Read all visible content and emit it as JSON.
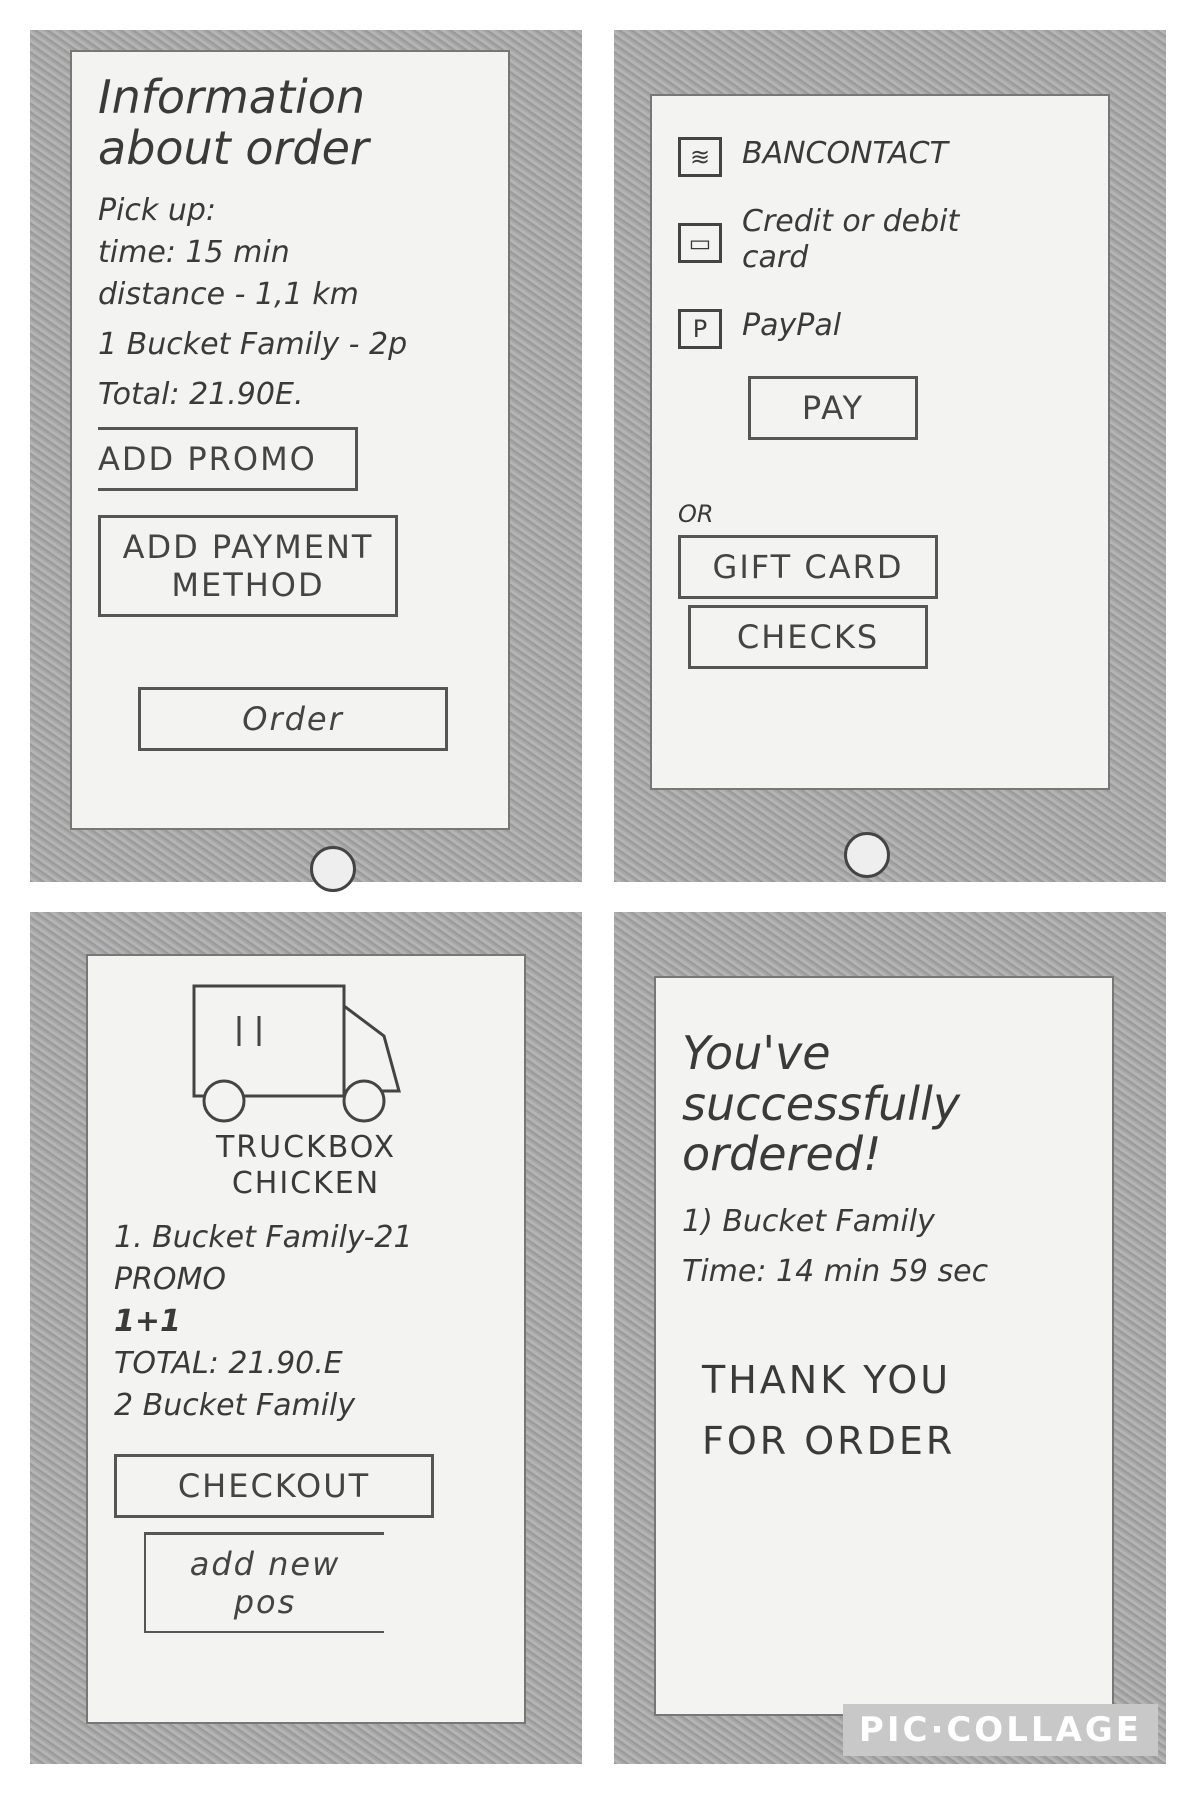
{
  "screen1": {
    "title": "Information about order",
    "pickup_label": "Pick up:",
    "time": "time: 15 min",
    "distance": "distance - 1,1 km",
    "item": "1 Bucket Family - 2p",
    "total": "Total: 21.90E.",
    "add_promo": "ADD PROMO",
    "add_payment": "ADD PAYMENT METHOD",
    "order": "Order"
  },
  "screen2": {
    "methods": [
      {
        "label": "BANCONTACT",
        "icon": "bancontact-icon"
      },
      {
        "label": "Credit or debit card",
        "icon": "card-icon"
      },
      {
        "label": "PayPal",
        "icon": "paypal-icon",
        "glyph": "P"
      }
    ],
    "pay": "PAY",
    "or": "OR",
    "gift_card": "GIFT CARD",
    "checks": "CHECKS"
  },
  "screen3": {
    "brand": "TRUCKBOX CHICKEN",
    "item": "1. Bucket Family-21",
    "promo_label": "PROMO",
    "promo_value": "1+1",
    "total": "TOTAL: 21.90.E",
    "result": "2 Bucket Family",
    "checkout": "CHECKOUT",
    "add_new": "add new pos"
  },
  "screen4": {
    "title": "You've successfully ordered!",
    "item": "1) Bucket Family",
    "time": "Time: 14 min 59 sec",
    "thanks": "THANK YOU FOR ORDER"
  },
  "watermark": "PIC·COLLAGE"
}
